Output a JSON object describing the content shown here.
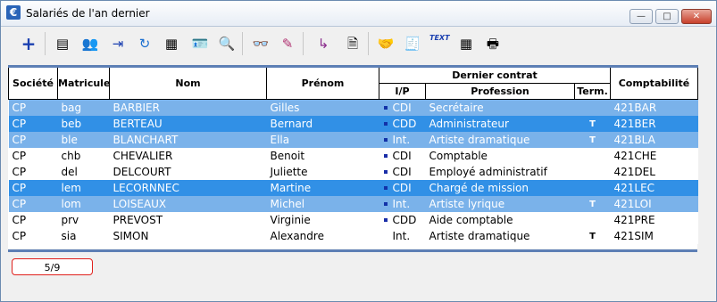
{
  "window": {
    "title": "Salariés de l'an dernier",
    "app_icon": "€"
  },
  "titlebar_buttons": {
    "minimize": "—",
    "maximize": "□",
    "close": "✕"
  },
  "toolbar": {
    "icons": [
      "plus-icon",
      "print-list-icon",
      "users-icon",
      "export-icon",
      "refresh-icon",
      "list-form-icon",
      "user-badge-icon",
      "magnifier-icon",
      "glasses-icon",
      "pen-icon",
      "return-arrow-icon",
      "document-transfer-icon",
      "handshake-icon",
      "calculator-doc-icon",
      "text-icon",
      "table-icon",
      "printer-icon"
    ],
    "glyphs": [
      "+",
      "▤",
      "👥",
      "⇥",
      "↻",
      "▦",
      "🪪",
      "🔍",
      "👓",
      "✎",
      "↳",
      "🗎",
      "🤝",
      "🧾",
      "TEXT",
      "▦",
      "🖶"
    ]
  },
  "columns": {
    "societe": "Société",
    "matricule": "Matricule",
    "nom": "Nom",
    "prenom": "Prénom",
    "dernier_contrat": "Dernier contrat",
    "ip": "I/P",
    "profession": "Profession",
    "term": "Term.",
    "comptabilite": "Comptabilité"
  },
  "rows": [
    {
      "societe": "CP",
      "matricule": "bag",
      "nom": "BARBIER",
      "prenom": "Gilles",
      "dot": true,
      "ip": "CDI",
      "profession": "Secrétaire",
      "term": "",
      "compta": "421BAR",
      "style": "light"
    },
    {
      "societe": "CP",
      "matricule": "beb",
      "nom": "BERTEAU",
      "prenom": "Bernard",
      "dot": false,
      "ip": "CDD",
      "profession": "Administrateur",
      "term": "T",
      "compta": "421BER",
      "style": "dark"
    },
    {
      "societe": "CP",
      "matricule": "ble",
      "nom": "BLANCHART",
      "prenom": "Ella",
      "dot": false,
      "ip": "Int.",
      "profession": "Artiste dramatique",
      "term": "T",
      "compta": "421BLA",
      "style": "light"
    },
    {
      "societe": "CP",
      "matricule": "chb",
      "nom": "CHEVALIER",
      "prenom": "Benoit",
      "dot": true,
      "ip": "CDI",
      "profession": "Comptable",
      "term": "",
      "compta": "421CHE",
      "style": "white"
    },
    {
      "societe": "CP",
      "matricule": "del",
      "nom": "DELCOURT",
      "prenom": "Juliette",
      "dot": true,
      "ip": "CDI",
      "profession": "Employé administratif",
      "term": "",
      "compta": "421DEL",
      "style": "white"
    },
    {
      "societe": "CP",
      "matricule": "lem",
      "nom": "LECORNNEC",
      "prenom": "Martine",
      "dot": true,
      "ip": "CDI",
      "profession": "Chargé de mission",
      "term": "",
      "compta": "421LEC",
      "style": "dark"
    },
    {
      "societe": "CP",
      "matricule": "lom",
      "nom": "LOISEAUX",
      "prenom": "Michel",
      "dot": false,
      "ip": "Int.",
      "profession": "Artiste lyrique",
      "term": "T",
      "compta": "421LOI",
      "style": "light"
    },
    {
      "societe": "CP",
      "matricule": "prv",
      "nom": "PREVOST",
      "prenom": "Virginie",
      "dot": true,
      "ip": "CDD",
      "profession": "Aide comptable",
      "term": "",
      "compta": "421PRE",
      "style": "white"
    },
    {
      "societe": "CP",
      "matricule": "sia",
      "nom": "SIMON",
      "prenom": "Alexandre",
      "dot": false,
      "ip": "Int.",
      "profession": "Artiste dramatique",
      "term": "T",
      "compta": "421SIM",
      "style": "white"
    }
  ],
  "status": {
    "counter": "5/9"
  },
  "colors": {
    "row_light": "#7ab2ea",
    "row_dark": "#3190e6",
    "header_line": "#5d7fb5",
    "counter_border": "#e0201c"
  }
}
